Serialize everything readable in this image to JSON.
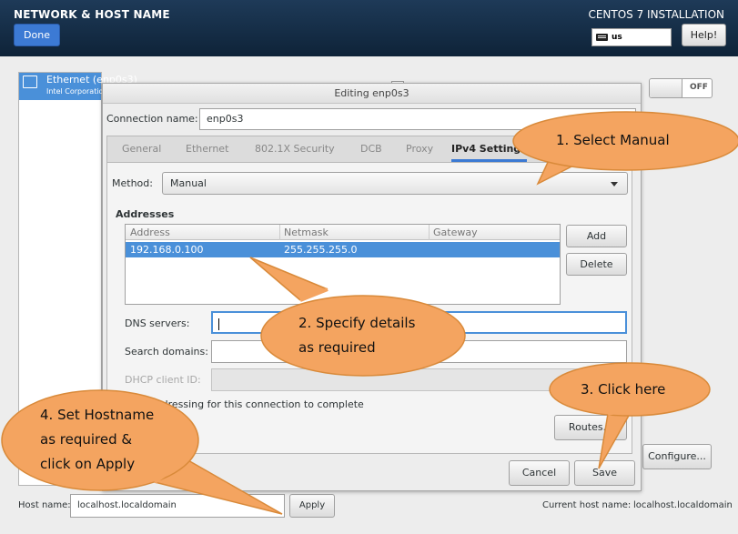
{
  "header": {
    "title": "NETWORK & HOST NAME",
    "done_label": "Done",
    "installer_title": "CENTOS 7 INSTALLATION",
    "keyboard_layout": "us",
    "help_label": "Help!"
  },
  "device": {
    "name": "Ethernet (enp0s3)",
    "vendor": "Intel Corporation",
    "toggle_state": "OFF",
    "configure_label": "Configure..."
  },
  "dialog": {
    "title": "Editing enp0s3",
    "connection_name_label": "Connection name:",
    "connection_name_value": "enp0s3",
    "tabs": [
      "General",
      "Ethernet",
      "802.1X Security",
      "DCB",
      "Proxy",
      "IPv4 Settings"
    ],
    "active_tab": "IPv4 Settings",
    "method_label": "Method:",
    "method_value": "Manual",
    "addresses_heading": "Addresses",
    "address_columns": [
      "Address",
      "Netmask",
      "Gateway"
    ],
    "address_rows": [
      {
        "address": "192.168.0.100",
        "netmask": "255.255.255.0",
        "gateway": ""
      }
    ],
    "add_label": "Add",
    "delete_label": "Delete",
    "dns_label": "DNS servers:",
    "dns_value": "",
    "search_label": "Search domains:",
    "search_value": "",
    "dhcp_label": "DHCP client ID:",
    "require_text": "IPv4 addressing for this connection to complete",
    "routes_label": "Routes...",
    "cancel_label": "Cancel",
    "save_label": "Save"
  },
  "hostname": {
    "label": "Host name:",
    "value": "localhost.localdomain",
    "apply_label": "Apply",
    "current_label": "Current host name:",
    "current_value": "localhost.localdomain"
  },
  "callouts": {
    "c1": "1. Select Manual",
    "c2_line1": "2. Specify details",
    "c2_line2": "as required",
    "c3": "3. Click here",
    "c4_line1": "4. Set Hostname",
    "c4_line2": "as required &",
    "c4_line3": "click on Apply"
  },
  "colors": {
    "header_bg": "#14304b",
    "accent": "#4a90d9",
    "callout_fill": "#f4a460",
    "callout_stroke": "#d98a3a"
  }
}
